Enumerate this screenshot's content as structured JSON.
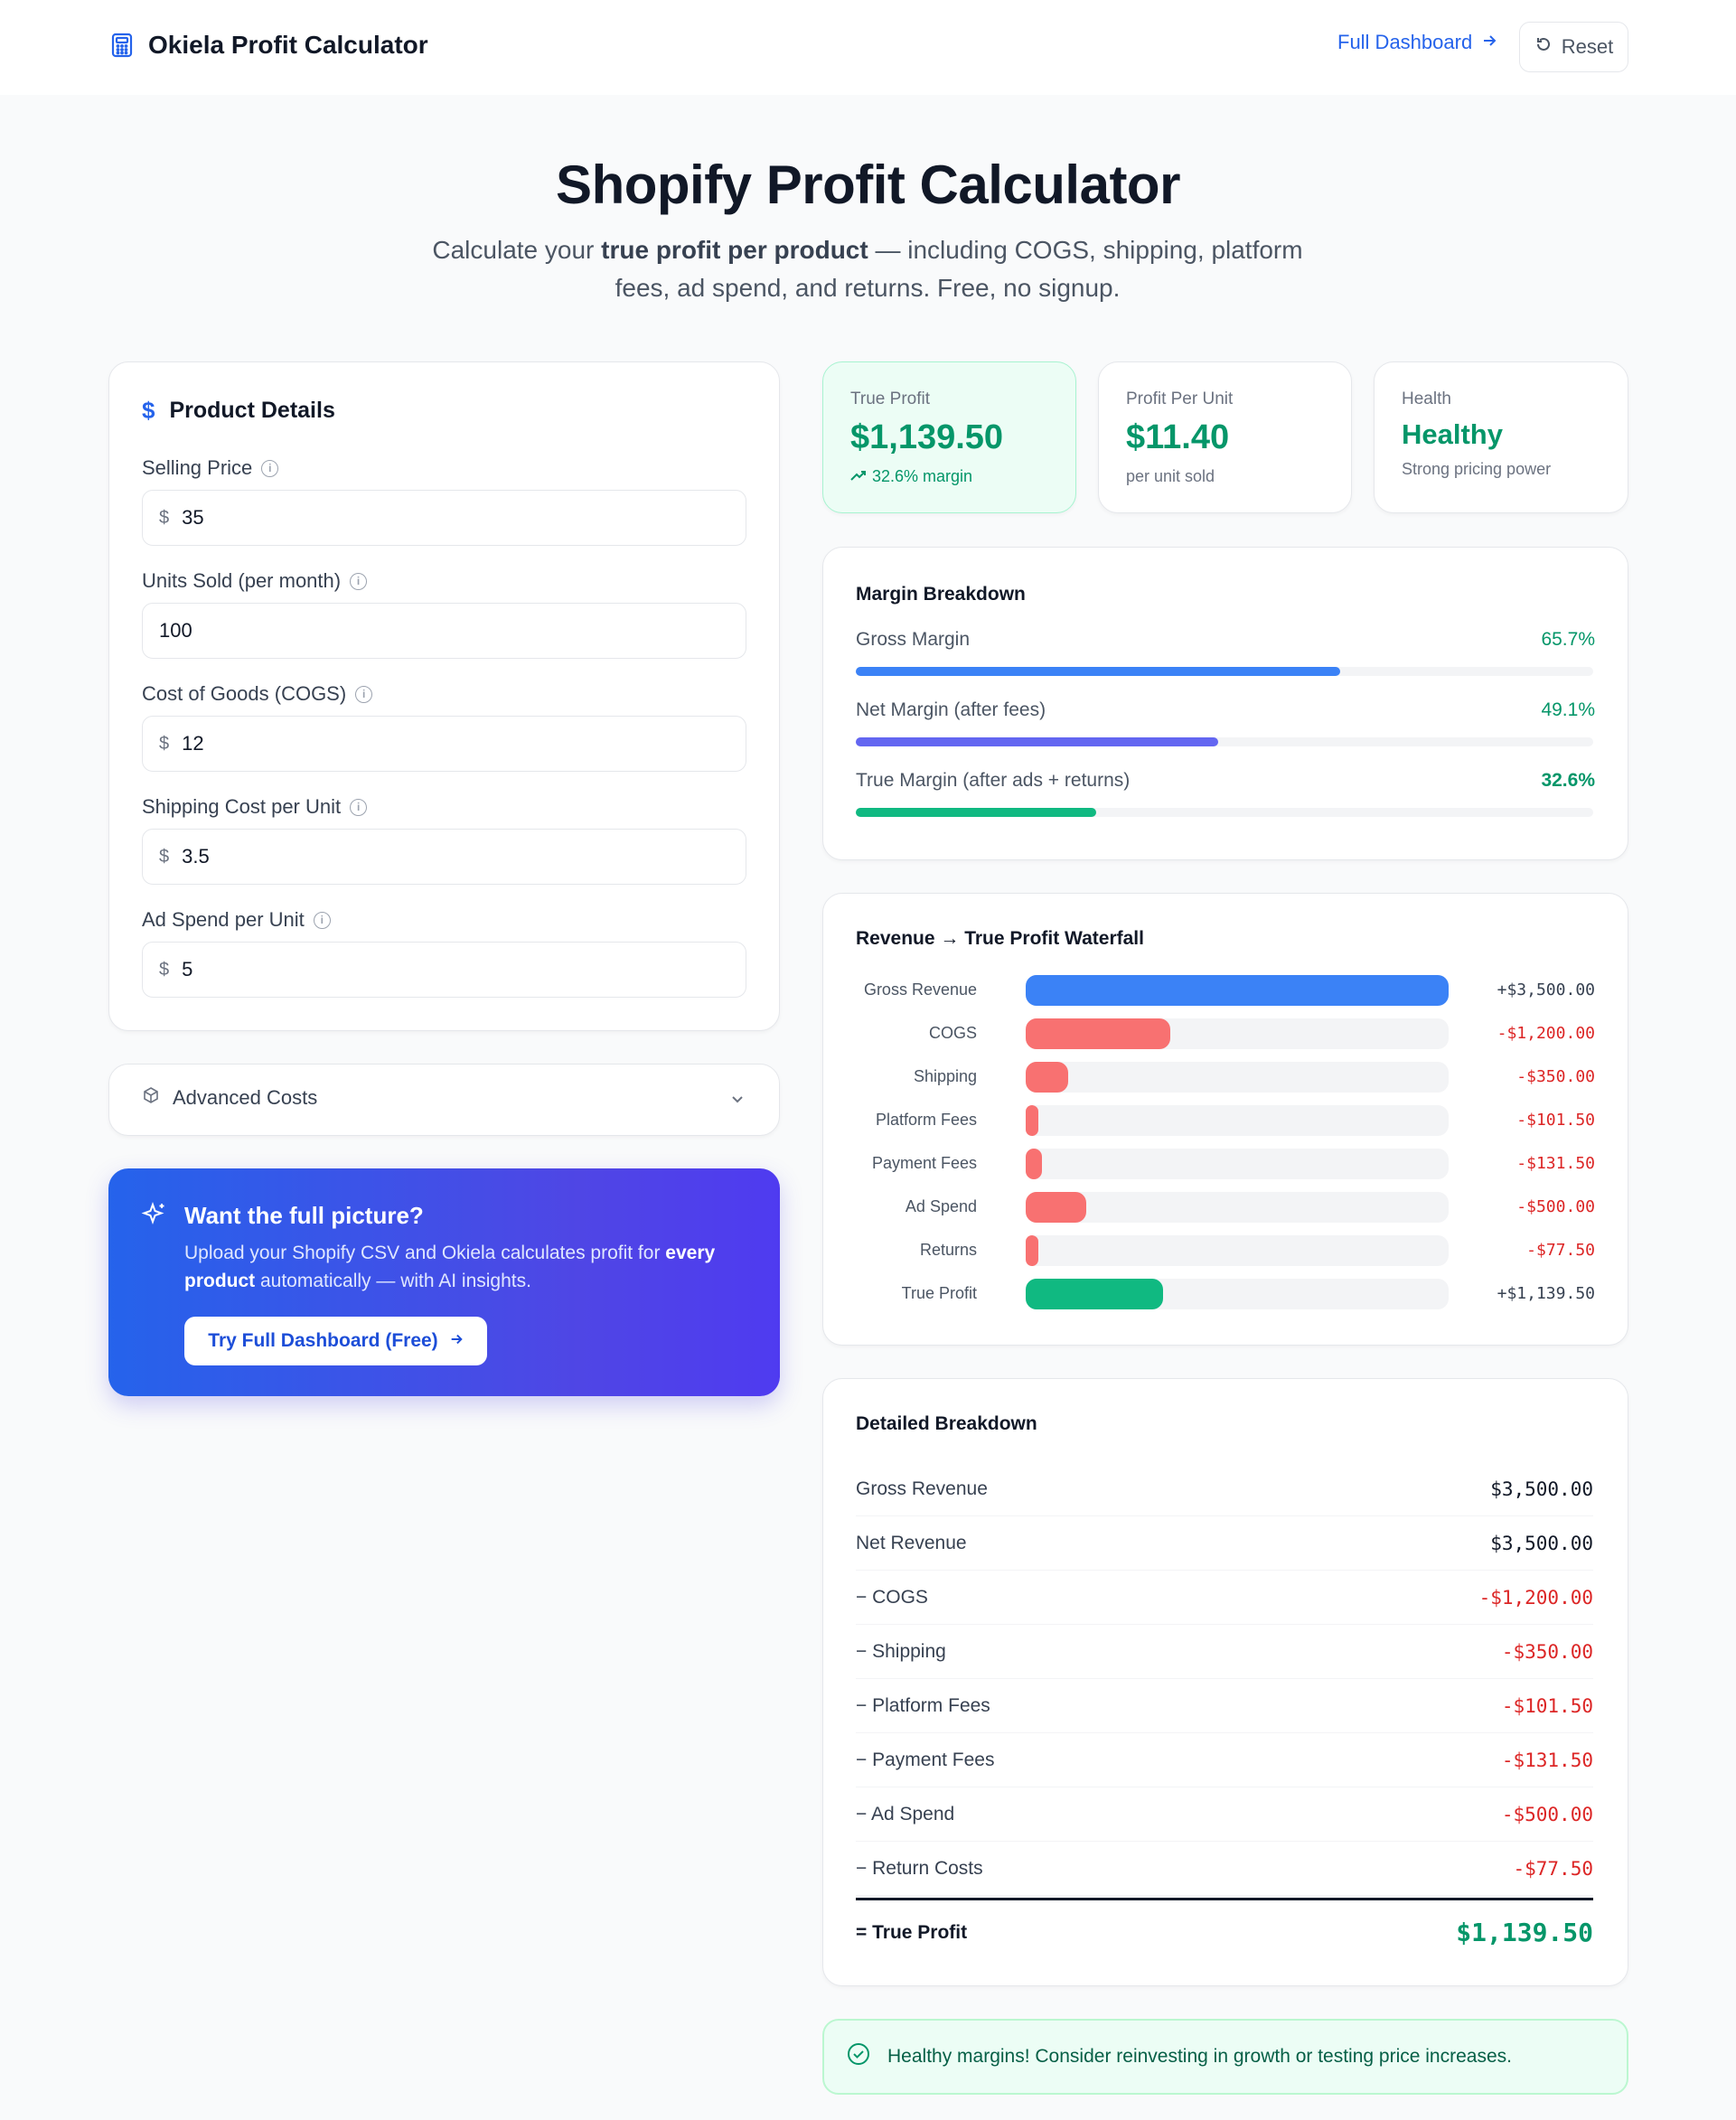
{
  "header": {
    "app_name": "Okiela Profit Calculator",
    "dashboard_link": "Full Dashboard",
    "reset_label": "Reset"
  },
  "hero": {
    "title": "Shopify Profit Calculator",
    "subtitle_pre": "Calculate your ",
    "subtitle_bold": "true profit per product",
    "subtitle_post": " — including COGS, shipping, platform fees, ad spend, and returns. Free, no signup."
  },
  "product_details": {
    "title": "Product Details",
    "fields": [
      {
        "label": "Selling Price",
        "prefix": "$",
        "value": "35"
      },
      {
        "label": "Units Sold (per month)",
        "prefix": "",
        "value": "100"
      },
      {
        "label": "Cost of Goods (COGS)",
        "prefix": "$",
        "value": "12"
      },
      {
        "label": "Shipping Cost per Unit",
        "prefix": "$",
        "value": "3.5"
      },
      {
        "label": "Ad Spend per Unit",
        "prefix": "$",
        "value": "5"
      }
    ]
  },
  "advanced": {
    "label": "Advanced Costs"
  },
  "cta": {
    "title": "Want the full picture?",
    "text_pre": "Upload your Shopify CSV and Okiela calculates profit for ",
    "text_bold": "every product",
    "text_post": " automatically — with AI insights.",
    "button": "Try Full Dashboard (Free)"
  },
  "stats": {
    "true_profit": {
      "label": "True Profit",
      "value": "$1,139.50",
      "sub": "32.6% margin"
    },
    "per_unit": {
      "label": "Profit Per Unit",
      "value": "$11.40",
      "sub": "per unit sold"
    },
    "health": {
      "label": "Health",
      "value": "Healthy",
      "sub": "Strong pricing power"
    }
  },
  "margin_breakdown": {
    "title": "Margin Breakdown",
    "rows": [
      {
        "label": "Gross Margin",
        "value": "65.7%",
        "pct": 65.7,
        "color": "#3b82f6"
      },
      {
        "label": "Net Margin (after fees)",
        "value": "49.1%",
        "pct": 49.1,
        "color": "#6366f1"
      },
      {
        "label": "True Margin (after ads + returns)",
        "value": "32.6%",
        "pct": 32.6,
        "color": "#10b981"
      }
    ]
  },
  "waterfall": {
    "title": "Revenue → True Profit Waterfall",
    "rows": [
      {
        "label": "Gross Revenue",
        "value": "+$3,500.00",
        "amount": 3500,
        "color": "#3b82f6",
        "sign": "pos"
      },
      {
        "label": "COGS",
        "value": "-$1,200.00",
        "amount": 1200,
        "color": "#f87171",
        "sign": "neg"
      },
      {
        "label": "Shipping",
        "value": "-$350.00",
        "amount": 350,
        "color": "#f87171",
        "sign": "neg"
      },
      {
        "label": "Platform Fees",
        "value": "-$101.50",
        "amount": 101.5,
        "color": "#f87171",
        "sign": "neg"
      },
      {
        "label": "Payment Fees",
        "value": "-$131.50",
        "amount": 131.5,
        "color": "#f87171",
        "sign": "neg"
      },
      {
        "label": "Ad Spend",
        "value": "-$500.00",
        "amount": 500,
        "color": "#f87171",
        "sign": "neg"
      },
      {
        "label": "Returns",
        "value": "-$77.50",
        "amount": 77.5,
        "color": "#f87171",
        "sign": "neg"
      },
      {
        "label": "True Profit",
        "value": "+$1,139.50",
        "amount": 1139.5,
        "color": "#10b981",
        "sign": "pos"
      }
    ]
  },
  "detailed": {
    "title": "Detailed Breakdown",
    "rows": [
      {
        "label": "Gross Revenue",
        "value": "$3,500.00",
        "sign": "pos"
      },
      {
        "label": "Net Revenue",
        "value": "$3,500.00",
        "sign": "pos"
      },
      {
        "label": "− COGS",
        "value": "-$1,200.00",
        "sign": "neg"
      },
      {
        "label": "− Shipping",
        "value": "-$350.00",
        "sign": "neg"
      },
      {
        "label": "− Platform Fees",
        "value": "-$101.50",
        "sign": "neg"
      },
      {
        "label": "− Payment Fees",
        "value": "-$131.50",
        "sign": "neg"
      },
      {
        "label": "− Ad Spend",
        "value": "-$500.00",
        "sign": "neg"
      },
      {
        "label": "− Return Costs",
        "value": "-$77.50",
        "sign": "neg"
      }
    ],
    "total_label": "= True Profit",
    "total_value": "$1,139.50"
  },
  "note": "Healthy margins! Consider reinvesting in growth or testing price increases.",
  "colors": {
    "accent": "#2563eb",
    "positive": "#059669",
    "negative": "#dc2626"
  }
}
